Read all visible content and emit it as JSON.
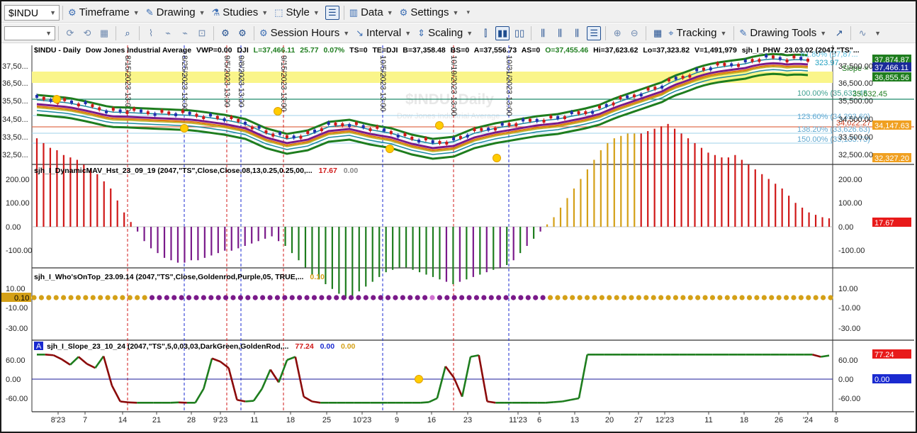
{
  "toolbar1": {
    "symbol": "$INDU",
    "timeframe": "Timeframe",
    "drawing": "Drawing",
    "studies": "Studies",
    "style": "Style",
    "data": "Data",
    "settings": "Settings"
  },
  "toolbar2": {
    "session_hours": "Session Hours",
    "interval": "Interval",
    "scaling": "Scaling",
    "tracking": "Tracking",
    "drawing_tools": "Drawing Tools"
  },
  "panel1": {
    "sym": "$INDU - Daily",
    "name": "Dow Jones Industrial Average",
    "vwp": "VWP=0.00",
    "exch": "DJI",
    "last": "L=37,466.11",
    "chg": "25.77",
    "pct": "0.07%",
    "ts": "TS=0",
    "te": "TE=DJI",
    "bid": "B=37,358.48",
    "bs": "BS=0",
    "ask": "A=37,556.73",
    "as": "AS=0",
    "open": "O=37,455.46",
    "hi": "Hi=37,623.62",
    "lo": "Lo=37,323.82",
    "vol": "V=1,491,979",
    "study": "sjh_I_PHW_23.03.02 (2047,\"TS\"...",
    "watermark1": "$INDU, Daily",
    "watermark2": "Dow Jones Industrial Average",
    "fib_100": "100.00% (35,632.45",
    "fib_12360": "123.60% (34,393.60)",
    "fib_13820": "138.20% (33,626.63)",
    "fib_150": "150.00% (33,133.73)",
    "fib_top": "61.80% (37,87...",
    "line_35632": "35,632.45",
    "line_34022": "34,022.27",
    "slope_lbl": "Slope =",
    "slope_val": "323.97",
    "tag_37874": "37,874.87",
    "tag_37466": "37,466.11",
    "tag_36855": "36,855.56",
    "tag_34147": "34,147.63",
    "tag_32327": "32,327.20",
    "axis": [
      "37,500.00",
      "36,500.00",
      "35,500.00",
      "34,500.00",
      "33,500.00",
      "32,500.00"
    ],
    "axis_left": [
      "37,50...",
      "36,50...",
      "35,50...",
      "34,50...",
      "33,50...",
      "32,50..."
    ],
    "date_labels": [
      "8/15/2023 13:00",
      "8/25/2023 13:00",
      "9/5/2023 13:00",
      "9/8/2023 13:00",
      "9/15/2023 13:00",
      "10/5/2023 13:00",
      "10/19/2023 13:00",
      "10/31/2023 13:00"
    ]
  },
  "panel2": {
    "title": "sjh_I_DynamicMAV_Hst_23_09_19 (2047,\"TS\",Close,Close,08,13,0.25,0.25,00,...",
    "val1": "17.67",
    "val2": "0.00",
    "tag": "17.67",
    "axis": [
      "200.00",
      "100.00",
      "0.00",
      "-100.00"
    ]
  },
  "panel3": {
    "title": "sjh_I_Who'sOnTop_23.09.14 (2047,\"TS\",Close,Goldenrod,Purple,05,  TRUE,...",
    "val1": "0.10",
    "tag": "0.10",
    "axis": [
      "10.00",
      "-10.00",
      "-30.00"
    ]
  },
  "panel4": {
    "badge": "A",
    "title": "sjh_I_Slope_23_10_24 (2047,\"TS\",5,0,03,03,DarkGreen,GoldenRod,...",
    "val1": "77.24",
    "val2": "0.00",
    "val3": "0.00",
    "tag1": "77.24",
    "tag2": "0.00",
    "axis": [
      "60.00",
      "0.00",
      "-60.00"
    ]
  },
  "xaxis": [
    "8'23",
    "7",
    "14",
    "21",
    "28",
    "9'23",
    "11",
    "18",
    "25",
    "10'23",
    "9",
    "16",
    "23",
    "11'23",
    "6",
    "13",
    "20",
    "27",
    "12'23",
    "11",
    "18",
    "26",
    "'24",
    "8"
  ],
  "colors": {
    "up": "#1f2fb0",
    "down": "#d01818",
    "green": "#1e7d1e",
    "purple": "#7a1a8a",
    "gold": "#d4a017",
    "teal": "#1b8aa0",
    "orange": "#e07a10",
    "darkred": "#8b0a0a",
    "highlight": "#faf58a"
  },
  "chart_data": [
    {
      "type": "bar",
      "title": "sjh_I_DynamicMAV_Hst_23_09_19",
      "ylim": [
        -150,
        240
      ],
      "values": [
        185,
        175,
        165,
        160,
        150,
        145,
        140,
        130,
        120,
        110,
        95,
        80,
        55,
        30,
        10,
        -10,
        -30,
        -45,
        -55,
        -65,
        -70,
        -75,
        -75,
        -70,
        -70,
        -65,
        -60,
        -55,
        -50,
        -50,
        -45,
        -40,
        -35,
        -30,
        -25,
        -20,
        -30,
        -40,
        -55,
        -70,
        -85,
        -100,
        -110,
        -120,
        -130,
        -140,
        -150,
        -145,
        -135,
        -125,
        -115,
        -105,
        -95,
        -90,
        -85,
        -85,
        -90,
        -95,
        -100,
        -105,
        -110,
        -115,
        -120,
        -115,
        -110,
        -105,
        -100,
        -95,
        -90,
        -85,
        -80,
        -70,
        -55,
        -40,
        -25,
        -10,
        5,
        20,
        40,
        60,
        80,
        100,
        120,
        140,
        160,
        175,
        185,
        190,
        195,
        195,
        195,
        200,
        205,
        210,
        215,
        205,
        195,
        185,
        175,
        165,
        155,
        150,
        145,
        145,
        150,
        140,
        130,
        120,
        110,
        100,
        90,
        80,
        65,
        50,
        40,
        30,
        25,
        20,
        17.67
      ]
    },
    {
      "type": "scatter",
      "title": "sjh_I_Who'sOnTop_23.09.14",
      "ylim": [
        -35,
        15
      ],
      "values": [
        0.1
      ]
    },
    {
      "type": "line",
      "title": "sjh_I_Slope_23_10_24",
      "ylim": [
        -75,
        90
      ],
      "values": [
        77,
        77,
        75,
        62,
        45,
        70,
        48,
        35,
        72,
        -20,
        -70,
        -73,
        -74,
        -74,
        -74,
        -74,
        -74,
        -73,
        -74,
        -74,
        -30,
        65,
        55,
        35,
        -65,
        -70,
        -68,
        -30,
        30,
        -10,
        60,
        70,
        -55,
        -70,
        -74,
        -74,
        -74,
        -74,
        -74,
        -74,
        -74,
        -74,
        -74,
        -74,
        -74,
        -74,
        -74,
        -72,
        -60,
        40,
        5,
        -55,
        70,
        75,
        -70,
        -74,
        -74,
        -74,
        -74,
        -74,
        -74,
        -74,
        -72,
        -70,
        -65,
        -60,
        77,
        77,
        77,
        77,
        77,
        77,
        77,
        77,
        77,
        77,
        77,
        77,
        77,
        77,
        77,
        77,
        77,
        77,
        77,
        77,
        77,
        77,
        77,
        77,
        77,
        77,
        77,
        77,
        70,
        74
      ]
    }
  ]
}
